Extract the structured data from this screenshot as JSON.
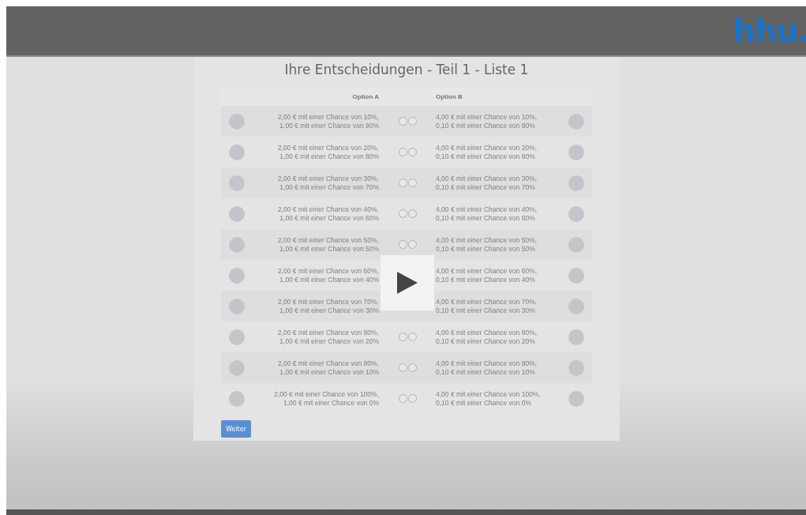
{
  "header": {
    "logo": "hhu."
  },
  "title": "Ihre Entscheidungen - Teil 1 - Liste 1",
  "table": {
    "columns": [
      "Option A",
      "Option B"
    ],
    "rows": [
      {
        "a1": "2,00 € mit einer Chance von 10%,",
        "a2": "1,00 € mit einer Chance von 90%",
        "b1": "4,00 € mit einer Chance von 10%,",
        "b2": "0,10 € mit einer Chance von 90%",
        "a_selected": false,
        "b_selected": false
      },
      {
        "a1": "2,00 € mit einer Chance von 20%,",
        "a2": "1,00 € mit einer Chance von 80%",
        "b1": "4,00 € mit einer Chance von 20%,",
        "b2": "0,10 € mit einer Chance von 80%",
        "a_selected": false,
        "b_selected": false
      },
      {
        "a1": "2,00 € mit einer Chance von 30%,",
        "a2": "1,00 € mit einer Chance von 70%",
        "b1": "4,00 € mit einer Chance von 30%,",
        "b2": "0,10 € mit einer Chance von 70%",
        "a_selected": false,
        "b_selected": false
      },
      {
        "a1": "2,00 € mit einer Chance von 40%,",
        "a2": "1,00 € mit einer Chance von 60%",
        "b1": "4,00 € mit einer Chance von 40%,",
        "b2": "0,10 € mit einer Chance von 60%",
        "a_selected": false,
        "b_selected": false
      },
      {
        "a1": "2,00 € mit einer Chance von 50%,",
        "a2": "1,00 € mit einer Chance von 50%",
        "b1": "4,00 € mit einer Chance von 50%,",
        "b2": "0,10 € mit einer Chance von 50%",
        "a_selected": false,
        "b_selected": false
      },
      {
        "a1": "2,00 € mit einer Chance von 60%,",
        "a2": "1,00 € mit einer Chance von 40%",
        "b1": "4,00 € mit einer Chance von 60%,",
        "b2": "0,10 € mit einer Chance von 40%"
      },
      {
        "a1": "2,00 € mit einer Chance von 70%,",
        "a2": "1,00 € mit einer Chance von 30%",
        "b1": "4,00 € mit einer Chance von 70%,",
        "b2": "0,10 € mit einer Chance von 30%"
      },
      {
        "a1": "2,00 € mit einer Chance von 80%,",
        "a2": "1,00 € mit einer Chance von 20%",
        "b1": "4,00 € mit einer Chance von 80%,",
        "b2": "0,10 € mit einer Chance von 20%",
        "a_selected": false,
        "b_selected": false
      },
      {
        "a1": "2,00 € mit einer Chance von 90%,",
        "a2": "1,00 € mit einer Chance von 10%",
        "b1": "4,00 € mit einer Chance von 90%,",
        "b2": "0,10 € mit einer Chance von 10%",
        "a_selected": false,
        "b_selected": false
      },
      {
        "a1": "2,00 € mit einer Chance von 100%,",
        "a2": "1,00 € mit einer Chance von 0%",
        "b1": "4,00 € mit einer Chance von 100%,",
        "b2": "0,10 € mit einer Chance von 0%",
        "a_selected": false,
        "b_selected": false
      }
    ]
  },
  "button": "Weiter"
}
